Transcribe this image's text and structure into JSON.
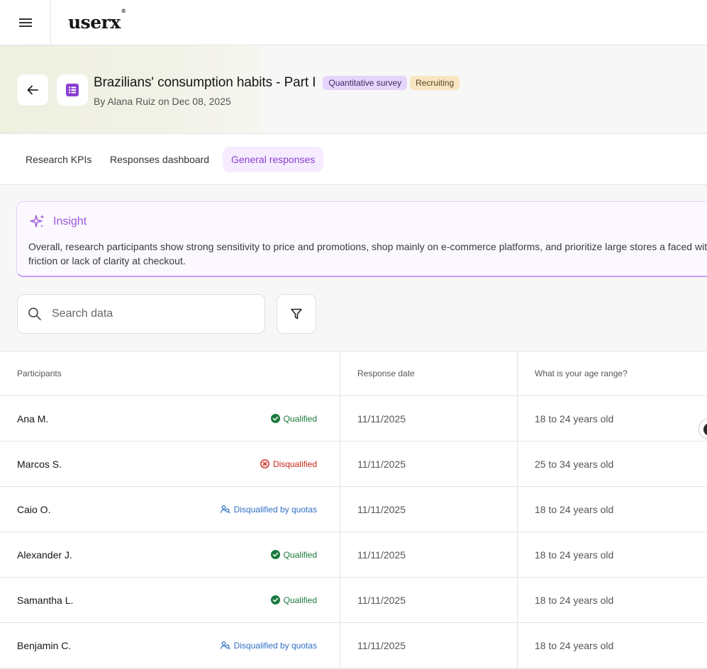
{
  "app": {
    "logo": "userx",
    "logo_mark": "®"
  },
  "survey": {
    "title": "Brazilians' consumption habits - Part I",
    "badges": [
      "Quantitative survey",
      "Recruiting"
    ],
    "subtitle": "By Alana Ruiz on Dec 08, 2025"
  },
  "tabs": [
    {
      "label": "Research KPIs",
      "active": false
    },
    {
      "label": "Responses dashboard",
      "active": false
    },
    {
      "label": "General responses",
      "active": true
    }
  ],
  "insight": {
    "title": "Insight",
    "text": "Overall, research participants show strong sensitivity to price and promotions, shop mainly on e-commerce platforms, and prioritize large stores a faced with friction or lack of clarity at checkout."
  },
  "search": {
    "placeholder": "Search data",
    "value": ""
  },
  "table": {
    "headers": [
      "Participants",
      "Response date",
      "What is your age range?"
    ],
    "rows": [
      {
        "name": "Ana M.",
        "status": "Qualified",
        "status_type": "qualified",
        "date": "11/11/2025",
        "age": "18 to 24 years old"
      },
      {
        "name": "Marcos S.",
        "status": "Disqualified",
        "status_type": "disqualified",
        "date": "11/11/2025",
        "age": "25 to 34 years old"
      },
      {
        "name": "Caio O.",
        "status": "Disqualified by quotas",
        "status_type": "quota",
        "date": "11/11/2025",
        "age": "18 to 24 years old"
      },
      {
        "name": "Alexander J.",
        "status": "Qualified",
        "status_type": "qualified",
        "date": "11/11/2025",
        "age": "18 to 24 years old"
      },
      {
        "name": "Samantha L.",
        "status": "Qualified",
        "status_type": "qualified",
        "date": "11/11/2025",
        "age": "18 to 24 years old"
      },
      {
        "name": "Benjamin C.",
        "status": "Disqualified by quotas",
        "status_type": "quota",
        "date": "11/11/2025",
        "age": "18 to 24 years old"
      }
    ]
  },
  "colors": {
    "accent": "#8a3fd1",
    "qualified": "#1b7a3e",
    "disqualified": "#c8261d",
    "quota": "#2f6fc4"
  },
  "icons": [
    "menu-icon",
    "arrow-left-icon",
    "list-icon",
    "sparkle-icon",
    "search-icon",
    "filter-icon",
    "check-circle-icon",
    "x-circle-icon",
    "users-search-icon"
  ]
}
